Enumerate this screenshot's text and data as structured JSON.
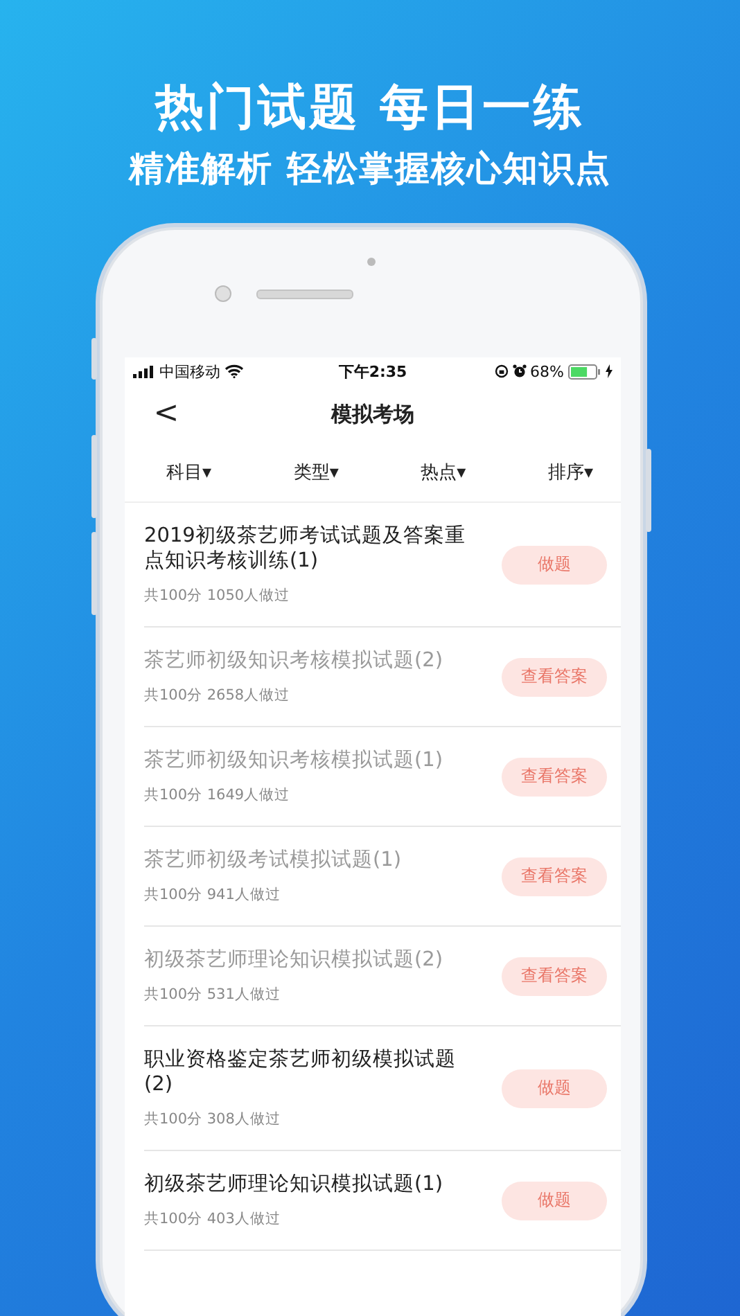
{
  "promo": {
    "headline": "热门试题 每日一练",
    "subline": "精准解析 轻松掌握核心知识点"
  },
  "status_bar": {
    "carrier": "中国移动",
    "time": "下午2:35",
    "battery": {
      "text": "68%",
      "level": 0.68
    }
  },
  "nav": {
    "back": "<",
    "title": "模拟考场"
  },
  "filters": [
    {
      "label": "科目",
      "caret": "▾"
    },
    {
      "label": "类型",
      "caret": "▾"
    },
    {
      "label": "热点",
      "caret": "▾"
    },
    {
      "label": "排序",
      "caret": "▾"
    }
  ],
  "exams": [
    {
      "title": "2019初级茶艺师考试试题及答案重点知识考核训练(1)",
      "meta": "共100分 1050人做过",
      "done": false,
      "button": "做题"
    },
    {
      "title": "茶艺师初级知识考核模拟试题(2)",
      "meta": "共100分 2658人做过",
      "done": true,
      "button": "查看答案"
    },
    {
      "title": "茶艺师初级知识考核模拟试题(1)",
      "meta": "共100分 1649人做过",
      "done": true,
      "button": "查看答案"
    },
    {
      "title": "茶艺师初级考试模拟试题(1)",
      "meta": "共100分 941人做过",
      "done": true,
      "button": "查看答案"
    },
    {
      "title": "初级茶艺师理论知识模拟试题(2)",
      "meta": "共100分 531人做过",
      "done": true,
      "button": "查看答案"
    },
    {
      "title": "职业资格鉴定茶艺师初级模拟试题(2)",
      "meta": "共100分 308人做过",
      "done": false,
      "button": "做题"
    },
    {
      "title": "初级茶艺师理论知识模拟试题(1)",
      "meta": "共100分 403人做过",
      "done": false,
      "button": "做题"
    }
  ]
}
